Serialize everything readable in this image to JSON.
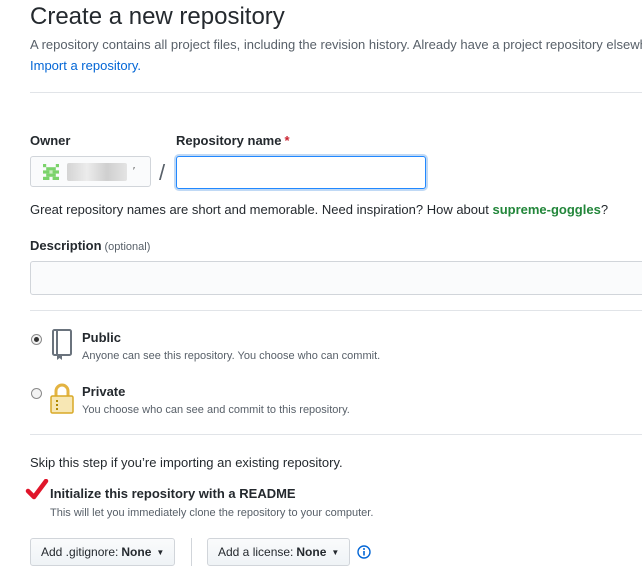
{
  "header": {
    "title": "Create a new repository",
    "subtitle": "A repository contains all project files, including the revision history. Already have a project repository elsewhere?",
    "import_link": "Import a repository."
  },
  "owner": {
    "label": "Owner"
  },
  "repo_name": {
    "label": "Repository name",
    "required_mark": "*",
    "separator": "/",
    "value": "",
    "hint_prefix": "Great repository names are short and memorable. Need inspiration? How about ",
    "suggestion": "supreme-goggles",
    "hint_suffix": "?"
  },
  "description": {
    "label": "Description",
    "optional": "(optional)",
    "value": ""
  },
  "visibility": {
    "public": {
      "title": "Public",
      "desc": "Anyone can see this repository. You choose who can commit.",
      "selected": true
    },
    "private": {
      "title": "Private",
      "desc": "You choose who can see and commit to this repository.",
      "selected": false
    }
  },
  "init": {
    "skip_text": "Skip this step if you’re importing an existing repository.",
    "readme_label": "Initialize this repository with a README",
    "readme_desc": "This will let you immediately clone the repository to your computer.",
    "readme_checked": true
  },
  "dropdowns": {
    "gitignore_prefix": "Add .gitignore:",
    "gitignore_value": "None",
    "license_prefix": "Add a license:",
    "license_value": "None"
  },
  "colors": {
    "link": "#0366d6",
    "suggestion": "#22863a",
    "checkmark": "#e0162b",
    "focus": "#2188ff"
  },
  "icons": {
    "owner_avatar": "identicon-icon",
    "public": "repo-book-icon",
    "private": "lock-icon",
    "readme_check": "checkmark-icon",
    "info": "info-icon"
  }
}
